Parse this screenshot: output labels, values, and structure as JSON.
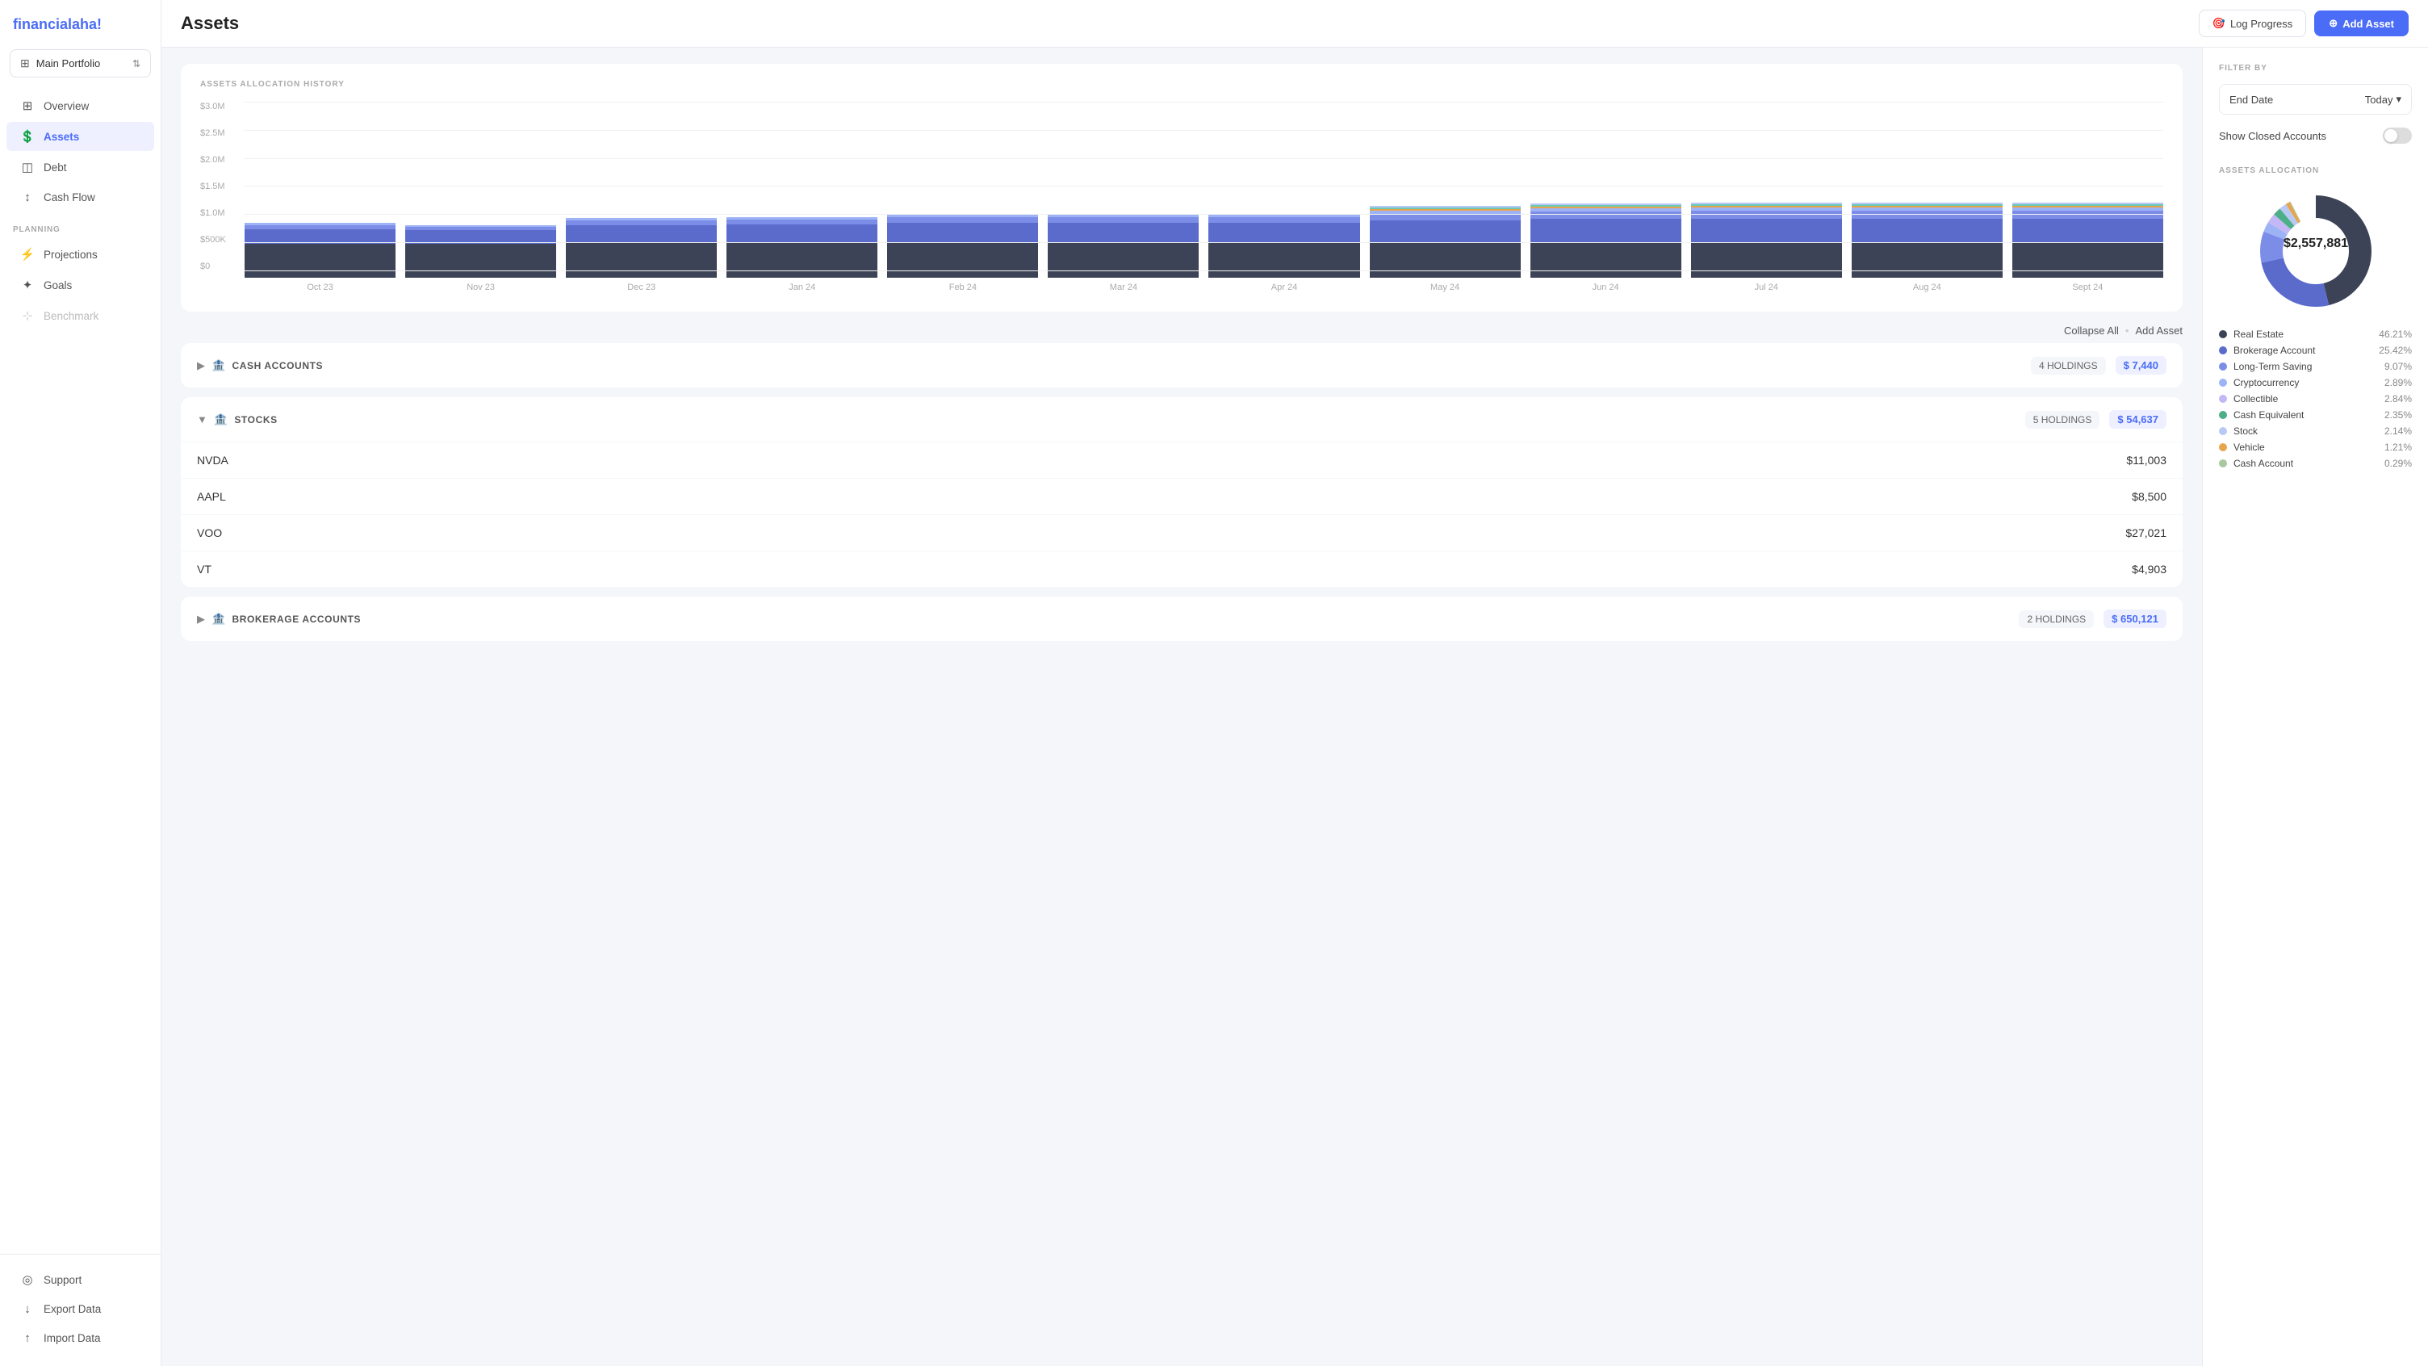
{
  "app": {
    "logo_text": "financial",
    "logo_accent": "aha!",
    "title": "Assets"
  },
  "sidebar": {
    "portfolio": {
      "name": "Main Portfolio",
      "arrow": "⇅"
    },
    "nav_items": [
      {
        "id": "overview",
        "label": "Overview",
        "icon": "⊞"
      },
      {
        "id": "assets",
        "label": "Assets",
        "icon": "💲",
        "active": true
      },
      {
        "id": "debt",
        "label": "Debt",
        "icon": "◫"
      },
      {
        "id": "cashflow",
        "label": "Cash Flow",
        "icon": "↕"
      }
    ],
    "planning_label": "PLANNING",
    "planning_items": [
      {
        "id": "projections",
        "label": "Projections",
        "icon": "⚡"
      },
      {
        "id": "goals",
        "label": "Goals",
        "icon": "✦"
      },
      {
        "id": "benchmark",
        "label": "Benchmark",
        "icon": "⊹",
        "disabled": true
      }
    ],
    "bottom_items": [
      {
        "id": "support",
        "label": "Support",
        "icon": "◎"
      },
      {
        "id": "export",
        "label": "Export Data",
        "icon": "↓"
      },
      {
        "id": "import",
        "label": "Import Data",
        "icon": "↑"
      }
    ]
  },
  "topbar": {
    "log_progress_label": "Log Progress",
    "add_asset_label": "Add Asset"
  },
  "chart": {
    "title": "ASSETS ALLOCATION HISTORY",
    "y_labels": [
      "$3.0M",
      "$2.5M",
      "$2.0M",
      "$1.5M",
      "$1.0M",
      "$500K",
      "$0"
    ],
    "bars": [
      {
        "label": "Oct 23",
        "segments": [
          {
            "color": "#3d4356",
            "height": 42
          },
          {
            "color": "#5b6bcc",
            "height": 18
          },
          {
            "color": "#7c8de8",
            "height": 5
          },
          {
            "color": "#9db3f5",
            "height": 3
          }
        ]
      },
      {
        "label": "Nov 23",
        "segments": [
          {
            "color": "#3d4356",
            "height": 42
          },
          {
            "color": "#5b6bcc",
            "height": 17
          },
          {
            "color": "#7c8de8",
            "height": 4
          },
          {
            "color": "#9db3f5",
            "height": 2
          }
        ]
      },
      {
        "label": "Dec 23",
        "segments": [
          {
            "color": "#3d4356",
            "height": 43
          },
          {
            "color": "#5b6bcc",
            "height": 22
          },
          {
            "color": "#7c8de8",
            "height": 6
          },
          {
            "color": "#9db3f5",
            "height": 3
          }
        ]
      },
      {
        "label": "Jan 24",
        "segments": [
          {
            "color": "#3d4356",
            "height": 43
          },
          {
            "color": "#5b6bcc",
            "height": 23
          },
          {
            "color": "#7c8de8",
            "height": 6
          },
          {
            "color": "#9db3f5",
            "height": 3
          }
        ]
      },
      {
        "label": "Feb 24",
        "segments": [
          {
            "color": "#3d4356",
            "height": 43
          },
          {
            "color": "#5b6bcc",
            "height": 25
          },
          {
            "color": "#7c8de8",
            "height": 7
          },
          {
            "color": "#9db3f5",
            "height": 3
          }
        ]
      },
      {
        "label": "Mar 24",
        "segments": [
          {
            "color": "#3d4356",
            "height": 43
          },
          {
            "color": "#5b6bcc",
            "height": 25
          },
          {
            "color": "#7c8de8",
            "height": 7
          },
          {
            "color": "#9db3f5",
            "height": 3
          }
        ]
      },
      {
        "label": "Apr 24",
        "segments": [
          {
            "color": "#3d4356",
            "height": 43
          },
          {
            "color": "#5b6bcc",
            "height": 25
          },
          {
            "color": "#7c8de8",
            "height": 7
          },
          {
            "color": "#9db3f5",
            "height": 3
          }
        ]
      },
      {
        "label": "May 24",
        "segments": [
          {
            "color": "#3d4356",
            "height": 43
          },
          {
            "color": "#5b6bcc",
            "height": 28
          },
          {
            "color": "#7c8de8",
            "height": 8
          },
          {
            "color": "#9db3f5",
            "height": 4
          },
          {
            "color": "#e8a44a",
            "height": 2
          },
          {
            "color": "#6bc9b5",
            "height": 2
          },
          {
            "color": "#b8c9f5",
            "height": 2
          }
        ]
      },
      {
        "label": "Jun 24",
        "segments": [
          {
            "color": "#3d4356",
            "height": 43
          },
          {
            "color": "#5b6bcc",
            "height": 30
          },
          {
            "color": "#7c8de8",
            "height": 9
          },
          {
            "color": "#9db3f5",
            "height": 4
          },
          {
            "color": "#e8a44a",
            "height": 2
          },
          {
            "color": "#6bc9b5",
            "height": 2
          },
          {
            "color": "#b8c9f5",
            "height": 2
          }
        ]
      },
      {
        "label": "Jul 24",
        "segments": [
          {
            "color": "#3d4356",
            "height": 43
          },
          {
            "color": "#5b6bcc",
            "height": 30
          },
          {
            "color": "#7c8de8",
            "height": 10
          },
          {
            "color": "#9db3f5",
            "height": 4
          },
          {
            "color": "#e8a44a",
            "height": 2
          },
          {
            "color": "#6bc9b5",
            "height": 2
          },
          {
            "color": "#b8c9f5",
            "height": 2
          }
        ]
      },
      {
        "label": "Aug 24",
        "segments": [
          {
            "color": "#3d4356",
            "height": 43
          },
          {
            "color": "#5b6bcc",
            "height": 30
          },
          {
            "color": "#7c8de8",
            "height": 10
          },
          {
            "color": "#9db3f5",
            "height": 4
          },
          {
            "color": "#e8a44a",
            "height": 2
          },
          {
            "color": "#6bc9b5",
            "height": 2
          },
          {
            "color": "#b8c9f5",
            "height": 2
          }
        ]
      },
      {
        "label": "Sept 24",
        "segments": [
          {
            "color": "#3d4356",
            "height": 43
          },
          {
            "color": "#5b6bcc",
            "height": 30
          },
          {
            "color": "#7c8de8",
            "height": 10
          },
          {
            "color": "#9db3f5",
            "height": 4
          },
          {
            "color": "#e8a44a",
            "height": 2
          },
          {
            "color": "#6bc9b5",
            "height": 2
          },
          {
            "color": "#b8c9f5",
            "height": 2
          }
        ]
      }
    ]
  },
  "toolbar": {
    "collapse_all": "Collapse All",
    "add_asset": "Add Asset",
    "dot": "•"
  },
  "categories": [
    {
      "id": "cash",
      "name": "CASH ACCOUNTS",
      "icon": "🏦",
      "collapsed": true,
      "holdings": "4 HOLDINGS",
      "value": "$ 7,440",
      "stocks": []
    },
    {
      "id": "stocks",
      "name": "STOCKS",
      "icon": "📈",
      "collapsed": false,
      "holdings": "5 HOLDINGS",
      "value": "$ 54,637",
      "stocks": [
        {
          "name": "NVDA",
          "value": "$11,003"
        },
        {
          "name": "AAPL",
          "value": "$8,500"
        },
        {
          "name": "VOO",
          "value": "$27,021"
        },
        {
          "name": "VT",
          "value": "$4,903"
        }
      ]
    },
    {
      "id": "brokerage",
      "name": "BROKERAGE ACCOUNTS",
      "icon": "🏦",
      "collapsed": true,
      "holdings": "2 HOLDINGS",
      "value": "$ 650,121",
      "stocks": []
    }
  ],
  "right_panel": {
    "filter_label": "FILTER BY",
    "end_date_label": "End Date",
    "end_date_value": "Today",
    "show_closed_label": "Show Closed Accounts",
    "allocation_label": "ASSETS ALLOCATION",
    "total": "$2,557,881",
    "legend": [
      {
        "label": "Real Estate",
        "pct": "46.21%",
        "color": "#3d4356"
      },
      {
        "label": "Brokerage Account",
        "pct": "25.42%",
        "color": "#5b6bcc"
      },
      {
        "label": "Long-Term Saving",
        "pct": "9.07%",
        "color": "#7c8de8"
      },
      {
        "label": "Cryptocurrency",
        "pct": "2.89%",
        "color": "#9db3f5"
      },
      {
        "label": "Collectible",
        "pct": "2.84%",
        "color": "#c3b8f5"
      },
      {
        "label": "Cash Equivalent",
        "pct": "2.35%",
        "color": "#4caf88"
      },
      {
        "label": "Stock",
        "pct": "2.14%",
        "color": "#b8c9f5"
      },
      {
        "label": "Vehicle",
        "pct": "1.21%",
        "color": "#e8a44a"
      },
      {
        "label": "Cash Account",
        "pct": "0.29%",
        "color": "#a8c8a0"
      }
    ]
  }
}
